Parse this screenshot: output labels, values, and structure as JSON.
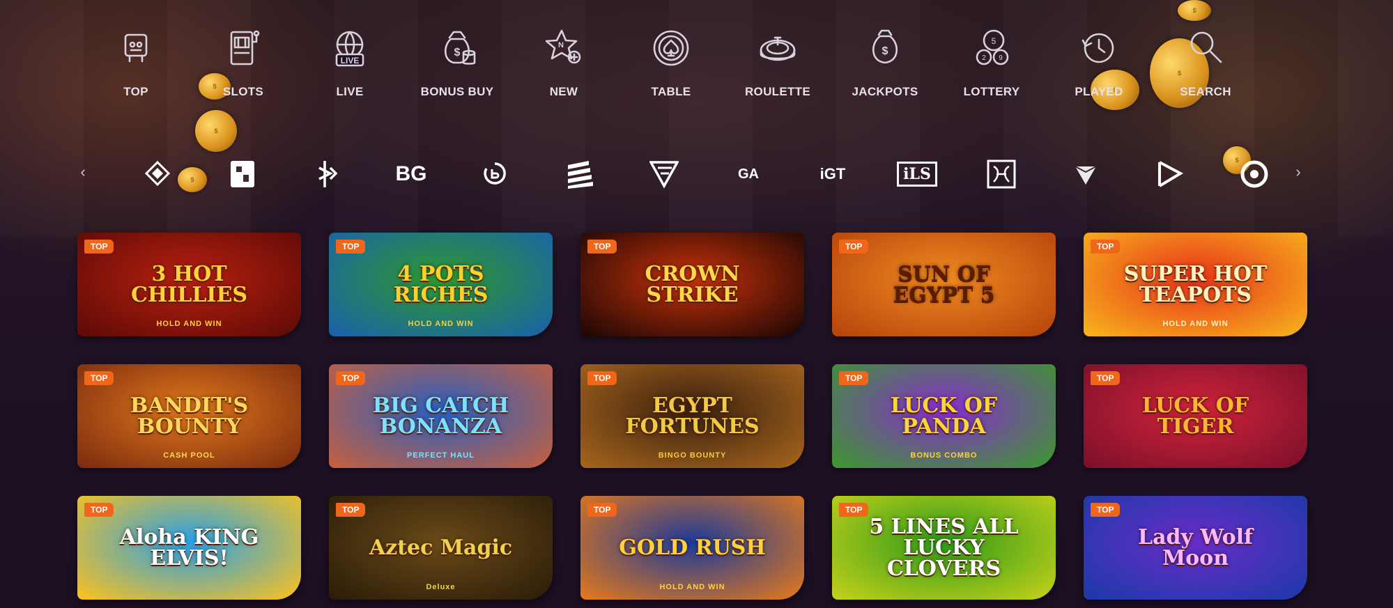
{
  "categories": [
    {
      "label": "TOP",
      "icon": "robot-top-icon"
    },
    {
      "label": "SLOTS",
      "icon": "slot-machine-icon"
    },
    {
      "label": "LIVE",
      "icon": "live-globe-icon"
    },
    {
      "label": "BONUS BUY",
      "icon": "money-bag-coins-icon"
    },
    {
      "label": "NEW",
      "icon": "star-new-icon"
    },
    {
      "label": "TABLE",
      "icon": "spade-chip-icon"
    },
    {
      "label": "ROULETTE",
      "icon": "roulette-wheel-icon"
    },
    {
      "label": "JACKPOTS",
      "icon": "jackpot-bag-icon"
    },
    {
      "label": "LOTTERY",
      "icon": "lottery-balls-icon"
    },
    {
      "label": "PLAYED",
      "icon": "played-history-icon"
    },
    {
      "label": "SEARCH",
      "icon": "search-icon"
    }
  ],
  "providers": [
    {
      "name": "diamond-provider-logo",
      "text": ""
    },
    {
      "name": "square-provider-logo",
      "text": ""
    },
    {
      "name": "b-provider-logo",
      "text": ""
    },
    {
      "name": "bg-provider-logo",
      "text": "BG"
    },
    {
      "name": "b-circle-provider-logo",
      "text": ""
    },
    {
      "name": "stripes-provider-logo",
      "text": ""
    },
    {
      "name": "triangle-provider-logo",
      "text": ""
    },
    {
      "name": "ga-provider-logo",
      "text": "GA"
    },
    {
      "name": "igt-provider-logo",
      "text": "iGT"
    },
    {
      "name": "ls-provider-logo",
      "text": "iLS"
    },
    {
      "name": "ornament-provider-logo",
      "text": ""
    },
    {
      "name": "gem-provider-logo",
      "text": ""
    },
    {
      "name": "play-provider-logo",
      "text": ""
    },
    {
      "name": "ring-provider-logo",
      "text": ""
    }
  ],
  "badge_label": "TOP",
  "games": [
    {
      "title": "3 HOT CHILLIES",
      "sub": "HOLD AND WIN",
      "bg": "#b8200f",
      "bg2": "#5c0a06",
      "color": "#ffd23a"
    },
    {
      "title": "4 POTS RICHES",
      "sub": "HOLD AND WIN",
      "bg": "#2e9a2c",
      "bg2": "#1a5fae",
      "color": "#ffcf2e"
    },
    {
      "title": "CROWN STRIKE",
      "sub": "",
      "bg": "#c8320a",
      "bg2": "#1a0604",
      "color": "#ffd84a"
    },
    {
      "title": "SUN OF EGYPT 5",
      "sub": "",
      "bg": "#f08a1f",
      "bg2": "#b4420c",
      "color": "#5a1d00"
    },
    {
      "title": "SUPER HOT TEAPOTS",
      "sub": "HOLD AND WIN",
      "bg": "#e8321a",
      "bg2": "#f7b71c",
      "color": "#fff2c0"
    },
    {
      "title": "BANDIT'S BOUNTY",
      "sub": "CASH POOL",
      "bg": "#e0781c",
      "bg2": "#7a2a0e",
      "color": "#ffd85a"
    },
    {
      "title": "BIG CATCH BONANZA",
      "sub": "PERFECT HAUL",
      "bg": "#2a5fc0",
      "bg2": "#c8603c",
      "color": "#7ce0ff"
    },
    {
      "title": "EGYPT FORTUNES",
      "sub": "BINGO BOUNTY",
      "bg": "#3a2010",
      "bg2": "#a8661c",
      "color": "#f2cb45"
    },
    {
      "title": "LUCK OF PANDA",
      "sub": "BONUS COMBO",
      "bg": "#8a2cd0",
      "bg2": "#3a9a2a",
      "color": "#ffd43a"
    },
    {
      "title": "LUCK OF TIGER",
      "sub": "",
      "bg": "#d0243a",
      "bg2": "#7a0f2a",
      "color": "#ffb52e"
    },
    {
      "title": "Aloha KING ELVIS!",
      "sub": "",
      "bg": "#2aa0e6",
      "bg2": "#ffc21a",
      "color": "#ffffff"
    },
    {
      "title": "Aztec Magic",
      "sub": "Deluxe",
      "bg": "#6a4a18",
      "bg2": "#2a1c08",
      "color": "#f2d04a"
    },
    {
      "title": "GOLD RUSH",
      "sub": "HOLD AND WIN",
      "bg": "#1c3a9a",
      "bg2": "#e87a18",
      "color": "#ffd23a"
    },
    {
      "title": "5 LINES ALL LUCKY CLOVERS",
      "sub": "",
      "bg": "#2e9a1a",
      "bg2": "#c8d21a",
      "color": "#ffffff"
    },
    {
      "title": "Lady Wolf Moon",
      "sub": "",
      "bg": "#6a2cc8",
      "bg2": "#1a3aa8",
      "color": "#ffb8ff"
    }
  ]
}
